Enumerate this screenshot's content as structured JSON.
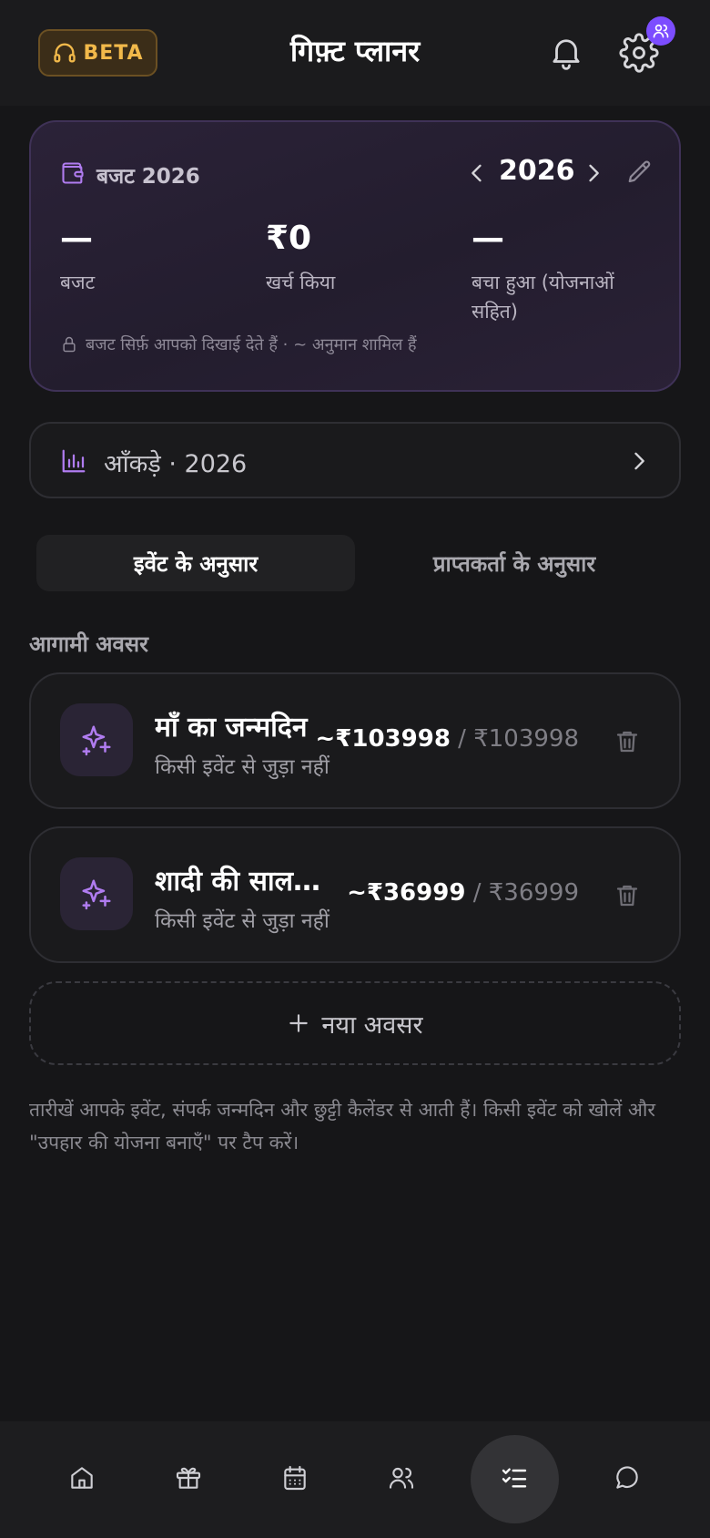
{
  "header": {
    "beta_label": "BETA",
    "title": "गिफ़्ट प्लानर",
    "icons": [
      "headset-icon",
      "bell-icon",
      "gear-icon",
      "users-icon"
    ],
    "beta_color": "#f2b94a",
    "badge_color": "#7c4dff"
  },
  "budget": {
    "label": "बजट 2026",
    "year": "2026",
    "stats": [
      {
        "value": "—",
        "label": "बजट"
      },
      {
        "value": "₹0",
        "label": "खर्च किया"
      },
      {
        "value": "—",
        "label": "बचा हुआ (योजनाओं सहित)"
      }
    ],
    "privacy_note": "बजट सिर्फ़ आपको दिखाई देते हैं · ~ अनुमान शामिल हैं"
  },
  "stats_link": {
    "label": "आँकड़े · 2026"
  },
  "tabs": [
    {
      "label": "इवेंट के अनुसार",
      "active": true
    },
    {
      "label": "प्राप्तकर्ता के अनुसार",
      "active": false
    }
  ],
  "section_title": "आगामी अवसर",
  "occasions": [
    {
      "name": "माँ का जन्मदिन",
      "subtitle": "किसी इवेंट से जुड़ा नहीं",
      "planned": "~₹103998",
      "separator": " / ",
      "total": "₹103998"
    },
    {
      "name": "शादी की सालगिरह",
      "subtitle": "किसी इवेंट से जुड़ा नहीं",
      "planned": "~₹36999",
      "separator": " / ",
      "total": "₹36999"
    }
  ],
  "new_occasion_label": "नया अवसर",
  "footnote": "तारीखें आपके इवेंट, संपर्क जन्मदिन और छुट्टी कैलेंडर से आती हैं। किसी इवेंट को खोलें और \"उपहार की योजना बनाएँ\" पर टैप करें।",
  "bottom_nav": {
    "items": [
      "home-icon",
      "gift-icon",
      "calendar-icon",
      "people-icon",
      "checklist-icon",
      "chat-icon"
    ],
    "active": "checklist-icon"
  },
  "colors": {
    "accent_purple": "#b07cf0",
    "background": "#161618"
  }
}
